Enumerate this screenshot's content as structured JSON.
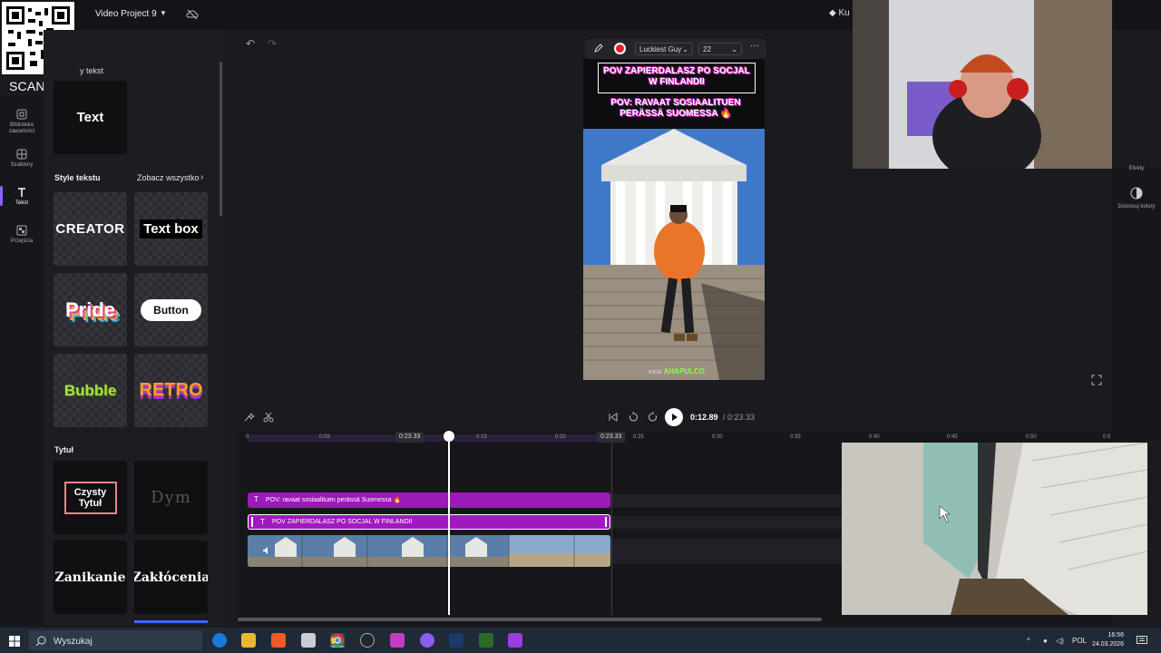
{
  "app": {
    "project_title": "Video Project 9",
    "premium_label": "Ku",
    "scan_me": "SCAN ME"
  },
  "rail": {
    "items": [
      {
        "label": "Biblioteka zawartości",
        "icon": "library-icon"
      },
      {
        "label": "Szablony",
        "icon": "templates-icon"
      },
      {
        "label": "Tekst",
        "icon": "text-icon"
      },
      {
        "label": "Przejścia",
        "icon": "transitions-icon"
      }
    ]
  },
  "panel": {
    "heading": "y tekst",
    "plain_text_tile": "Text",
    "styles_title": "Style tekstu",
    "see_all": "Zobacz wszystko",
    "style_tiles": [
      "CREATOR",
      "Text box",
      "Pride",
      "Button",
      "Bubble",
      "RETRO"
    ],
    "title_section": "Tytuł",
    "title_tiles": [
      "Czysty Tytuł",
      "Dym",
      "Zanikanie",
      "Zakłócenia"
    ]
  },
  "text_toolbar": {
    "font": "Luckiest Guy",
    "size": "22"
  },
  "preview": {
    "caption_top": "POV ZAPIERDALASZ PO SOCJAL W FINLANDII",
    "caption_bottom": "POV: RAVAAT SOSIAALITUEN PERÄSSÄ SUOMESSA 🔥",
    "kick_tag": "AHAPULCO",
    "kick_prefix": "KICK"
  },
  "right_rail": {
    "items": [
      {
        "label": "Efekty",
        "icon": "effects-icon"
      },
      {
        "label": "Dostosuj kolory",
        "icon": "adjust-colors-icon"
      }
    ]
  },
  "playback": {
    "current_time": "0:12.89",
    "total_time": "/ 0:23.33"
  },
  "ruler": {
    "labels": [
      "0",
      "0:05",
      "0:15",
      "0:20",
      "0:25",
      "0:30",
      "0:35",
      "0:40",
      "0:45",
      "0:50",
      "0:5"
    ],
    "badges": [
      "0:23.33",
      "0:23.33"
    ]
  },
  "timeline": {
    "clips": [
      {
        "label": "POV: ravaat sosiaalituen perässä Suomessa 🔥"
      },
      {
        "label": "POV ZAPIERDALASZ PO SOCJAL W FINLANDII"
      }
    ]
  },
  "taskbar": {
    "search_placeholder": "Wyszukaj",
    "language": "POL",
    "time": "16:56",
    "date": "24.03.2026"
  },
  "colors": {
    "accent": "#8a63ff",
    "clip_purple": "#9b1ab8",
    "clip_magenta": "#a01ac0"
  }
}
